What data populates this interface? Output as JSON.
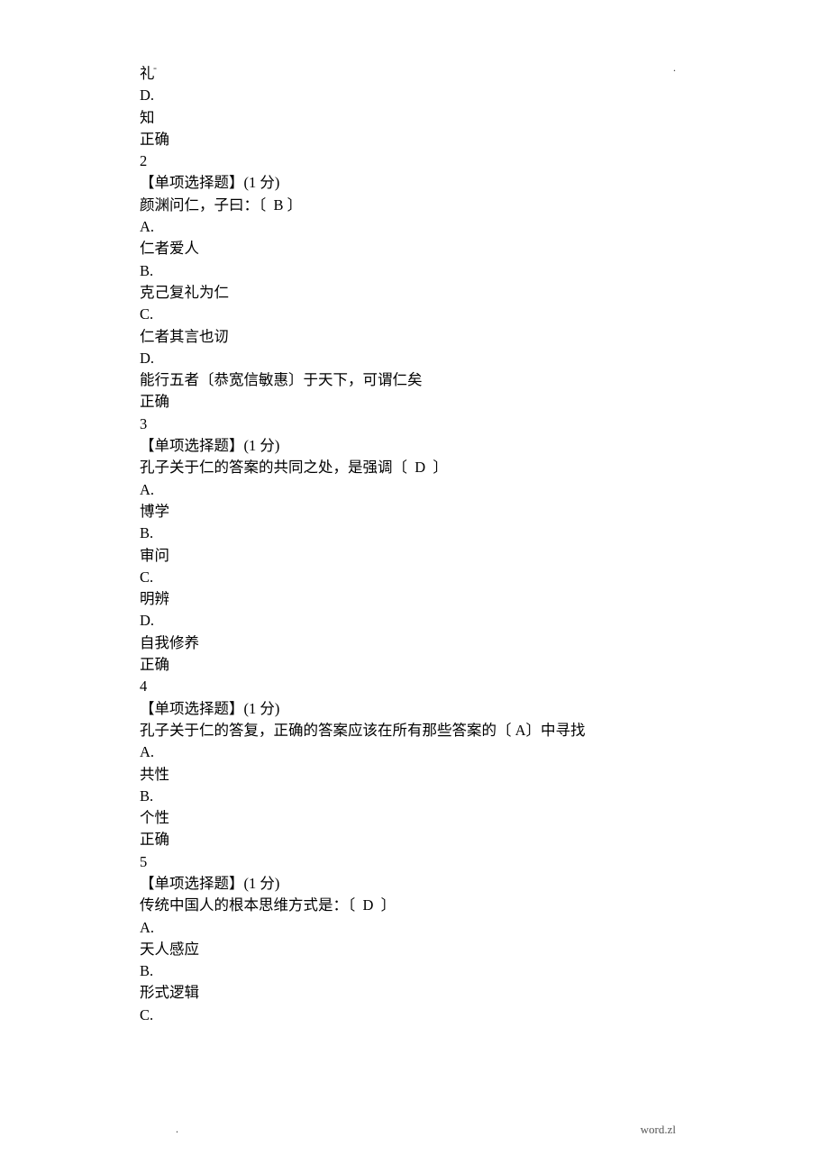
{
  "header": {
    "left": "-",
    "right": "."
  },
  "footer": {
    "left": ".",
    "right": "word.zl"
  },
  "partial_question": {
    "option_c_text": "礼",
    "label_d": "D.",
    "option_d_text": "知",
    "result": "正确"
  },
  "q2": {
    "number": "2",
    "type_label": "【单项选择题】(1 分)",
    "stem_prefix": "颜渊问仁，子曰：〔",
    "answer": "B",
    "stem_suffix": "〕",
    "label_a": "A.",
    "option_a": "仁者爱人",
    "label_b": "B.",
    "option_b": "克己复礼为仁",
    "label_c": "C.",
    "option_c": "仁者其言也讱",
    "label_d": "D.",
    "option_d": "能行五者〔恭宽信敏惠〕于天下，可谓仁矣",
    "result": "正确"
  },
  "q3": {
    "number": "3",
    "type_label": "【单项选择题】(1 分)",
    "stem_prefix": "孔子关于仁的答案的共同之处，是强调〔",
    "answer": "D",
    "stem_suffix": "〕",
    "label_a": "A.",
    "option_a": "博学",
    "label_b": "B.",
    "option_b": "审问",
    "label_c": "C.",
    "option_c": "明辨",
    "label_d": "D.",
    "option_d": "自我修养",
    "result": "正确"
  },
  "q4": {
    "number": "4",
    "type_label": "【单项选择题】(1 分)",
    "stem_prefix": "孔子关于仁的答复，正确的答案应该在所有那些答案的〔",
    "answer": "A",
    "stem_suffix": "〕中寻找",
    "label_a": "A.",
    "option_a": "共性",
    "label_b": "B.",
    "option_b": "个性",
    "result": "正确"
  },
  "q5": {
    "number": "5",
    "type_label": "【单项选择题】(1 分)",
    "stem_prefix": "传统中国人的根本思维方式是：〔",
    "answer": "D",
    "stem_suffix": "〕",
    "label_a": "A.",
    "option_a": "天人感应",
    "label_b": "B.",
    "option_b": "形式逻辑",
    "label_c": "C."
  }
}
